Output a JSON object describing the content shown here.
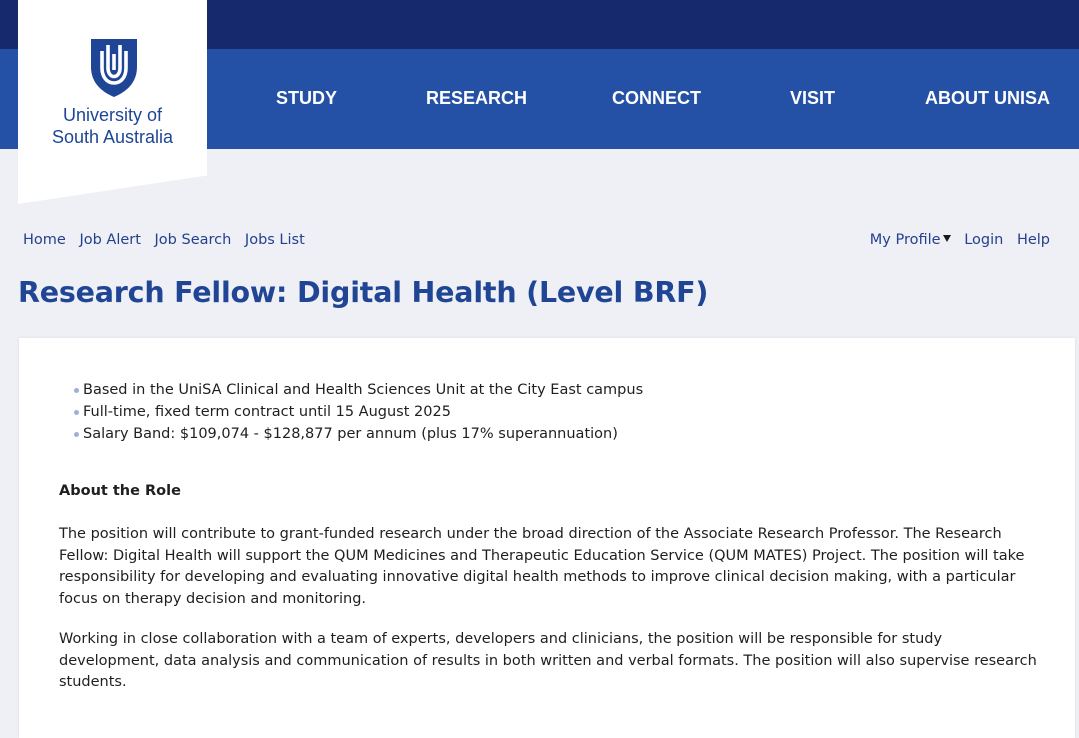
{
  "brand": {
    "logo_line1": "University of",
    "logo_line2": "South Australia"
  },
  "nav": {
    "items": [
      "STUDY",
      "RESEARCH",
      "CONNECT",
      "VISIT",
      "ABOUT UNISA"
    ]
  },
  "breadcrumbs": [
    "Home",
    "Job Alert",
    "Job Search",
    "Jobs List"
  ],
  "account": {
    "profile": "My Profile",
    "login": "Login",
    "help": "Help"
  },
  "job": {
    "title": "Research Fellow: Digital Health (Level BRF)",
    "bullets": [
      "Based in the UniSA Clinical and Health Sciences Unit at the City East campus",
      "Full-time, fixed term contract until 15 August 2025",
      "Salary Band: $109,074 - $128,877 per annum (plus 17% superannuation)"
    ],
    "about_heading": "About the Role",
    "paragraphs": [
      "The position will contribute to grant-funded research under the broad direction of the Associate Research Professor. The Research Fellow: Digital Health will support the QUM Medicines and Therapeutic Education Service (QUM MATES) Project. The position will take responsibility for developing and evaluating innovative digital health methods to improve clinical decision making, with a particular focus on therapy decision and monitoring.",
      "Working in close collaboration with a team of experts, developers and clinicians, the position will be responsible for study development, data analysis and communication of results in both written and verbal formats. The position will also supervise research students."
    ]
  },
  "colors": {
    "topbar": "#15296c",
    "navbar": "#2450a6",
    "link": "#24408f",
    "title": "#1f4594"
  }
}
